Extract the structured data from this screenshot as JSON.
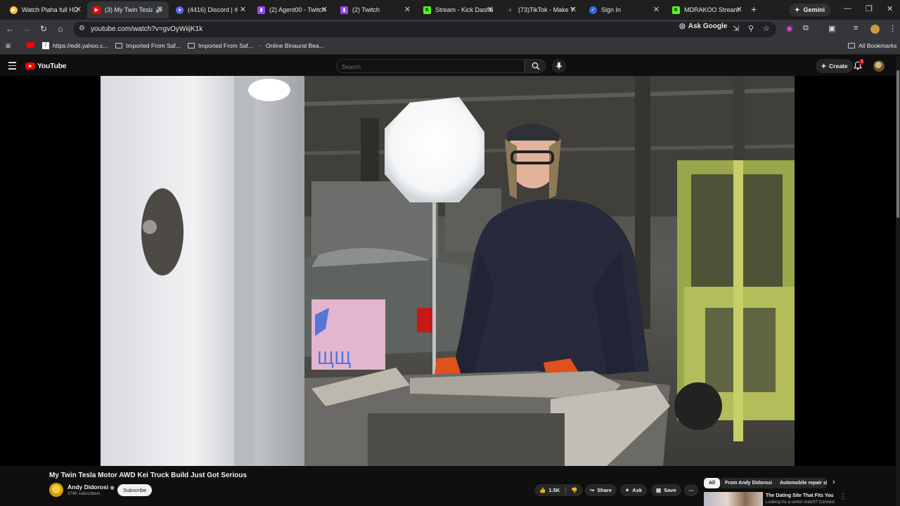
{
  "browser": {
    "tabs": [
      {
        "label": "Watch Plaha full HD",
        "favicon_color": "#f7c325",
        "active": false
      },
      {
        "label": "(3) My Twin Tesla",
        "favicon_color": "#ff0000",
        "active": true,
        "audio": true
      },
      {
        "label": "(4416) Discord | #",
        "favicon_color": "#5865f2",
        "active": false
      },
      {
        "label": "(2) Agent00 - Twitch",
        "favicon_color": "#9146ff",
        "active": false
      },
      {
        "label": "(2) Twitch",
        "favicon_color": "#9146ff",
        "active": false
      },
      {
        "label": "Stream - Kick Dashb",
        "favicon_color": "#53fc18",
        "active": false
      },
      {
        "label": "(73)TikTok - Make Y",
        "favicon_color": "#222222",
        "active": false
      },
      {
        "label": "Sign In",
        "favicon_color": "#2b6de8",
        "active": false
      },
      {
        "label": "MDRAKOO Stream",
        "favicon_color": "#53fc18",
        "active": false
      }
    ],
    "gemini_label": "Gemini",
    "url": "youtube.com/watch?v=gvOyWiijK1k",
    "ask_google_label": "Ask Google",
    "bookmarks": [
      {
        "label": "https://edit.yahoo.c...",
        "type": "link"
      },
      {
        "label": "Imported From Saf...",
        "type": "folder"
      },
      {
        "label": "Imported From Saf...",
        "type": "folder"
      },
      {
        "label": "Online Binaural Bea...",
        "type": "link"
      }
    ],
    "all_bookmarks_label": "All Bookmarks"
  },
  "youtube": {
    "logo_text": "YouTube",
    "search_placeholder": "Search",
    "create_label": "Create",
    "notification_count": "3",
    "video": {
      "title": "My Twin Tesla Motor AWD Kei Truck Build Just Got Serious",
      "channel": "Andy Didorosi",
      "subscribers": "374K subscribers",
      "subscribe_label": "Subscribe",
      "likes": "1.5K",
      "share_label": "Share",
      "ask_label": "Ask",
      "save_label": "Save"
    },
    "chips": [
      "All",
      "From Andy Didorosi",
      "Automobile repair sh"
    ],
    "ad": {
      "title": "The Dating Site That Fits You",
      "subtitle": "Looking for a senior match? Connect"
    }
  },
  "colors": {
    "youtube_red": "#ff0000",
    "page_bg": "#0f0f0f",
    "browser_chrome": "#35363a"
  }
}
